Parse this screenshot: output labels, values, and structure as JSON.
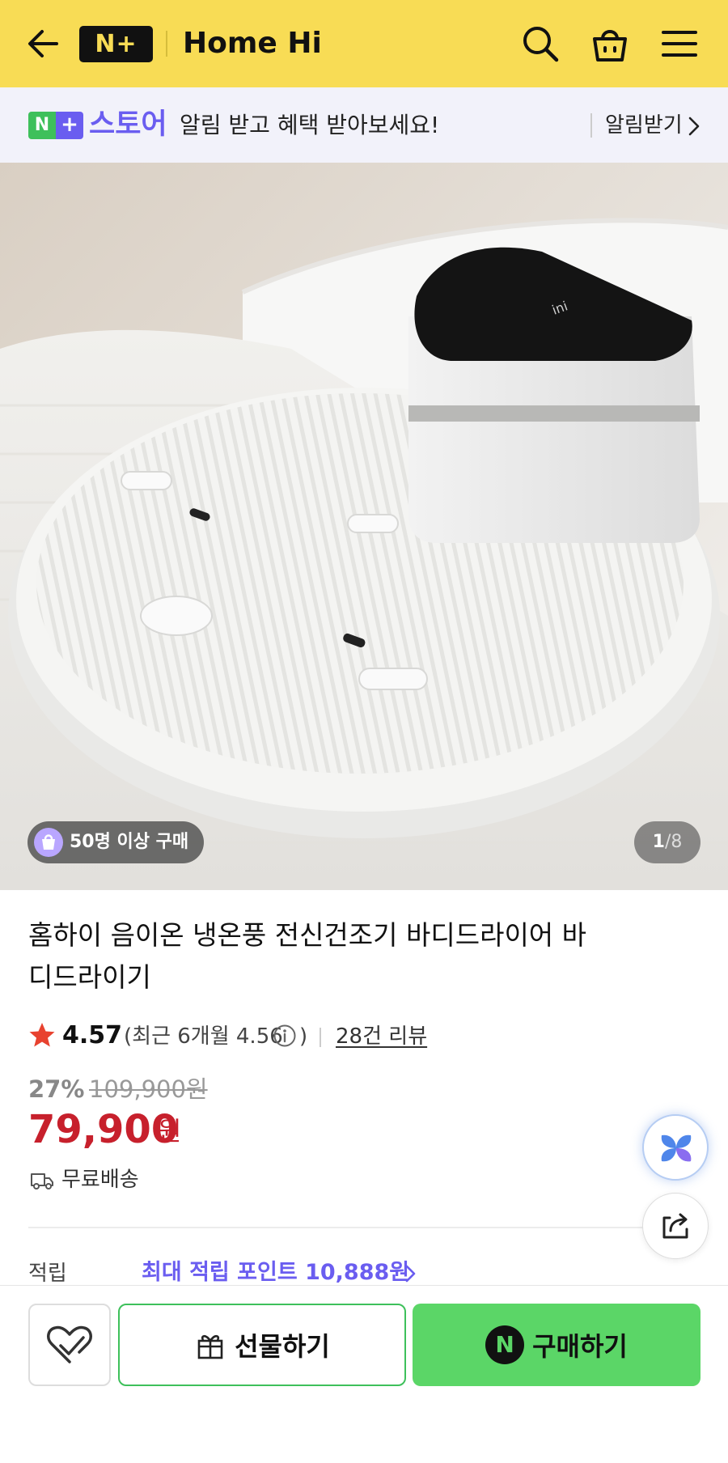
{
  "header": {
    "logo_text": "N+",
    "store_name": "Home Hi",
    "icons": [
      "back-arrow-icon",
      "search-icon",
      "shopping-bag-icon",
      "menu-icon"
    ],
    "background_color": "#f8dc55"
  },
  "promo_banner": {
    "badge_n": "N",
    "badge_plus": "+",
    "store_word": "스토어",
    "message": "알림 받고 혜택 받아보세요!",
    "link_label": "알림받기",
    "accent_color": "#6a5df0"
  },
  "hero": {
    "buyers_badge": "50명 이상 구매",
    "counter_current": "1",
    "counter_total": "/8"
  },
  "product": {
    "title": "홈하이 음이온 냉온풍 전신건조기 바디드라이어 바디드라이기",
    "rating": "4.57",
    "recent_rating": "(최근 6개월 4.56",
    "recent_rating_close": ")",
    "review_link": "28건 리뷰",
    "discount": "27%",
    "original_price": "109,900원",
    "sale_price": "79,900",
    "sale_unit": "원",
    "price_color": "#c7202c",
    "shipping": "무료배송",
    "points_label": "적립",
    "points_value": "최대 적립 포인트 10,888원"
  },
  "floating": {
    "icons": [
      "ai-assistant-icon",
      "share-icon"
    ]
  },
  "bottom_bar": {
    "gift_label": "선물하기",
    "buy_badge": "N",
    "buy_label": "구매하기",
    "buy_color": "#5bd667"
  }
}
